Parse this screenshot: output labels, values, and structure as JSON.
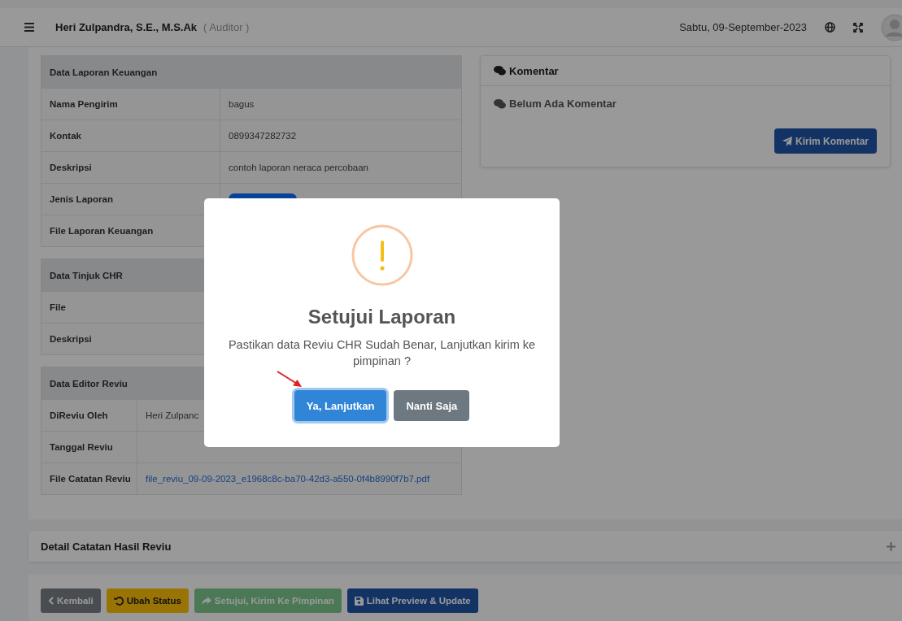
{
  "topbar": {
    "user_name": "Heri Zulpandra, S.E., M.S.Ak",
    "role": "( Auditor )",
    "date": "Sabtu, 09-September-2023"
  },
  "report_sections": [
    {
      "title": "Data Laporan Keuangan",
      "rows": [
        {
          "label": "Nama Pengirim",
          "kind": "text",
          "value": "bagus"
        },
        {
          "label": "Kontak",
          "kind": "text",
          "value": "0899347282732"
        },
        {
          "label": "Deskripsi",
          "kind": "text",
          "value": "contoh laporan neraca percobaan"
        },
        {
          "label": "Jenis Laporan",
          "kind": "badge"
        },
        {
          "label": "File Laporan Keuangan",
          "kind": "text"
        }
      ]
    },
    {
      "title": "Data Tinjuk CHR",
      "rows": [
        {
          "label": "File",
          "kind": "text"
        },
        {
          "label": "Deskripsi",
          "kind": "text"
        }
      ]
    },
    {
      "title": "Data Editor Reviu",
      "rows": [
        {
          "label": "DiReviu Oleh",
          "kind": "text",
          "value": "Heri Zulpanc"
        },
        {
          "label": "Tanggal Reviu",
          "kind": "text"
        },
        {
          "label": "File Catatan Reviu",
          "kind": "link",
          "value": "file_reviu_09-09-2023_e1968c8c-ba70-42d3-a550-0f4b8990f7b7.pdf"
        }
      ]
    }
  ],
  "comments": {
    "title": "Komentar",
    "empty_text": "Belum Ada Komentar",
    "button": "Kirim Komentar"
  },
  "collapsed_panel": {
    "title": "Detail Catatan Hasil Reviu",
    "expanded": false
  },
  "action_buttons": [
    {
      "label": "Kembali",
      "kind": "back",
      "disabled": false
    },
    {
      "label": "Ubah Status",
      "kind": "warning",
      "disabled": false
    },
    {
      "label": "Setujui, Kirim Ke Pimpinan",
      "kind": "success",
      "disabled": true
    },
    {
      "label": "Lihat Preview & Update",
      "kind": "primary",
      "disabled": false
    }
  ],
  "modal": {
    "title": "Setujui Laporan",
    "message": "Pastikan data Reviu CHR Sudah Benar, Lanjutkan kirim ke pimpinan ?",
    "buttons": [
      {
        "label": "Ya, Lanjutkan",
        "kind": "confirm",
        "focused": true
      },
      {
        "label": "Nanti Saja",
        "kind": "cancel",
        "focused": false
      }
    ]
  }
}
